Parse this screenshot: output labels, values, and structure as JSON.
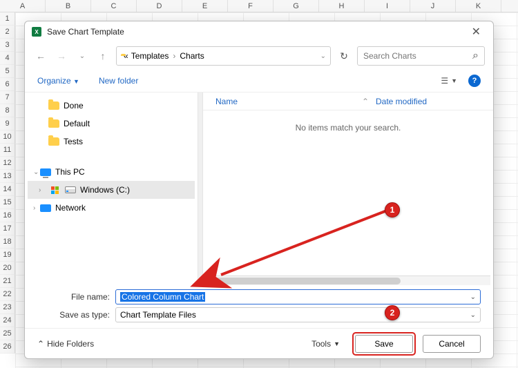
{
  "columns": [
    "A",
    "B",
    "C",
    "D",
    "E",
    "F",
    "G",
    "H",
    "I",
    "J",
    "K"
  ],
  "rows": [
    "1",
    "2",
    "3",
    "4",
    "5",
    "6",
    "7",
    "8",
    "9",
    "10",
    "11",
    "12",
    "13",
    "14",
    "15",
    "16",
    "17",
    "18",
    "19",
    "20",
    "21",
    "22",
    "23",
    "24",
    "25",
    "26"
  ],
  "dialog": {
    "title": "Save Chart Template",
    "breadcrumb": {
      "prefix": "«",
      "a": "Templates",
      "b": "Charts"
    },
    "search": {
      "placeholder": "Search Charts"
    },
    "toolbar": {
      "organize": "Organize",
      "newfolder": "New folder"
    },
    "tree": {
      "done": "Done",
      "default": "Default",
      "tests": "Tests",
      "thispc": "This PC",
      "cdrive": "Windows (C:)",
      "network": "Network"
    },
    "list": {
      "name": "Name",
      "date": "Date modified",
      "empty": "No items match your search."
    },
    "fields": {
      "filename_label": "File name:",
      "filename_value": "Colored Column Chart",
      "type_label": "Save as type:",
      "type_value": "Chart Template Files"
    },
    "footer": {
      "hidefolders": "Hide Folders",
      "tools": "Tools",
      "save": "Save",
      "cancel": "Cancel"
    }
  },
  "annotations": {
    "b1": "1",
    "b2": "2"
  }
}
